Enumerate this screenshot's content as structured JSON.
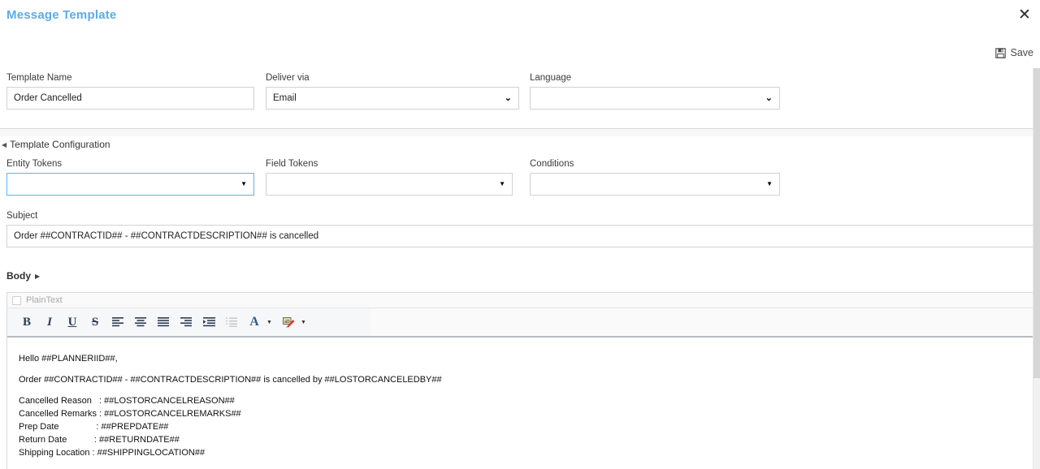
{
  "header": {
    "title": "Message Template",
    "close_icon": "close-icon",
    "save_label": "Save",
    "save_icon": "save-floppy-icon",
    "title_color": "#59ace8"
  },
  "form": {
    "template_name": {
      "label": "Template Name",
      "value": "Order Cancelled",
      "placeholder": ""
    },
    "deliver_via": {
      "label": "Deliver via",
      "value": "Email",
      "options": [
        "Email"
      ]
    },
    "language": {
      "label": "Language",
      "value": "",
      "options": []
    }
  },
  "template_configuration": {
    "section_title": "Template Configuration",
    "caret_icon": "caret-left-icon",
    "entity_tokens": {
      "label": "Entity Tokens",
      "value": "",
      "focused": true,
      "focus_color": "#5cb3f0"
    },
    "field_tokens": {
      "label": "Field Tokens",
      "value": ""
    },
    "conditions": {
      "label": "Conditions",
      "value": ""
    }
  },
  "subject": {
    "label": "Subject",
    "value": "Order ##CONTRACTID## - ##CONTRACTDESCRIPTION## is cancelled"
  },
  "body": {
    "label": "Body",
    "caret_icon": "caret-right-icon",
    "plaintext_tab": "PlainText",
    "plaintext_checked": false,
    "toolbar": [
      {
        "name": "bold-icon",
        "glyph": "B"
      },
      {
        "name": "italic-icon",
        "glyph": "I"
      },
      {
        "name": "underline-icon",
        "glyph": "U"
      },
      {
        "name": "strikethrough-icon",
        "glyph": "S"
      },
      {
        "name": "align-left-icon",
        "glyph": ""
      },
      {
        "name": "align-center-icon",
        "glyph": ""
      },
      {
        "name": "align-justify-icon",
        "glyph": ""
      },
      {
        "name": "align-right-icon",
        "glyph": ""
      },
      {
        "name": "indent-icon",
        "glyph": ""
      },
      {
        "name": "numbered-list-icon",
        "glyph": ""
      },
      {
        "name": "font-color-icon",
        "glyph": "A"
      },
      {
        "name": "highlight-color-icon",
        "glyph": ""
      }
    ],
    "content_lines": [
      "Hello ##PLANNERIID##,",
      "Order ##CONTRACTID## - ##CONTRACTDESCRIPTION## is cancelled by ##LOSTORCANCELEDBY##",
      "Cancelled Reason   : ##LOSTORCANCELREASON##",
      "Cancelled Remarks : ##LOSTORCANCELREMARKS##",
      "Prep Date               : ##PREPDATE##",
      "Return Date           : ##RETURNDATE##",
      "Shipping Location : ##SHIPPINGLOCATION##"
    ]
  }
}
